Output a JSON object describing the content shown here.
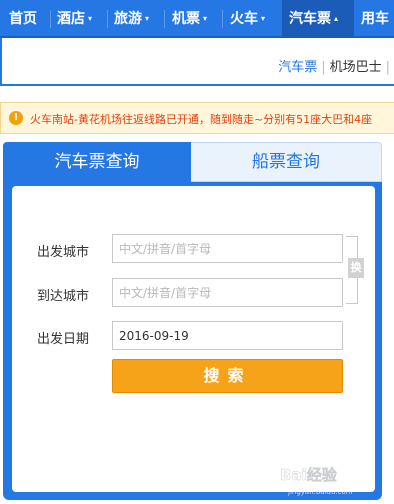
{
  "nav": {
    "items": [
      {
        "label": "首页",
        "caret": ""
      },
      {
        "label": "酒店",
        "caret": "▾"
      },
      {
        "label": "旅游",
        "caret": "▾"
      },
      {
        "label": "机票",
        "caret": "▾"
      },
      {
        "label": "火车",
        "caret": "▾"
      },
      {
        "label": "汽车票",
        "caret": "▴"
      },
      {
        "label": "用车",
        "caret": ""
      }
    ]
  },
  "subnav": {
    "links": [
      "汽车票",
      "机场巴士"
    ],
    "separator": "|"
  },
  "notice": {
    "icon": "!",
    "text": "火车南站-黄花机场往返线路已开通，随到随走~分别有51座大巴和4座"
  },
  "tabs": {
    "bus": "汽车票查询",
    "ship": "船票查询"
  },
  "form": {
    "from_label": "出发城市",
    "from_placeholder": "中文/拼音/首字母",
    "to_label": "到达城市",
    "to_placeholder": "中文/拼音/首字母",
    "date_label": "出发日期",
    "date_value": "2016-09-19",
    "swap_label": "换",
    "search_label": "搜索"
  },
  "watermark": {
    "text": "Bai经验",
    "url_text": "jingyan.baidu.com"
  },
  "colors": {
    "primary": "#2577e3",
    "search_button": "#f7a31a",
    "notice_text": "#e0420f"
  }
}
